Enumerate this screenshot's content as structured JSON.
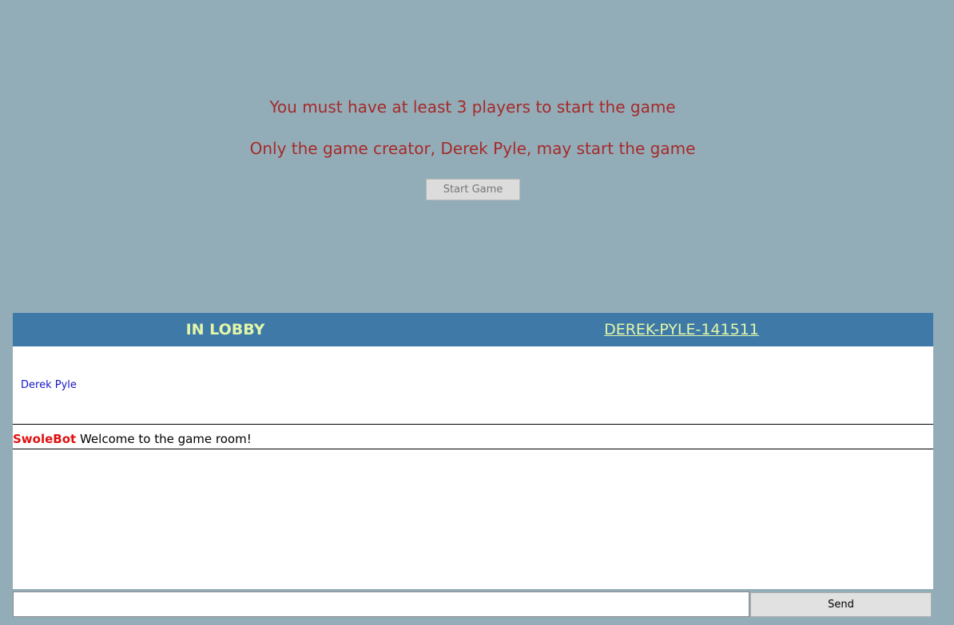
{
  "messages": {
    "min_players": "You must have at least 3 players to start the game",
    "creator_only": "Only the game creator, Derek Pyle, may start the game"
  },
  "start_button": {
    "label": "Start Game"
  },
  "lobby": {
    "title": "IN LOBBY",
    "room_id": "DEREK-PYLE-141511"
  },
  "players": [
    {
      "name": "Derek Pyle"
    }
  ],
  "chat": {
    "messages": [
      {
        "sender": "SwoleBot",
        "text": "Welcome to the game room!"
      }
    ],
    "input_value": "",
    "send_label": "Send"
  },
  "colors": {
    "background": "#93adb8",
    "header_bar": "#3e79a8",
    "header_text": "#e3f7a8",
    "warning_text": "#a52a2a",
    "player_name": "#1515c8",
    "bot_sender": "#e01010"
  }
}
